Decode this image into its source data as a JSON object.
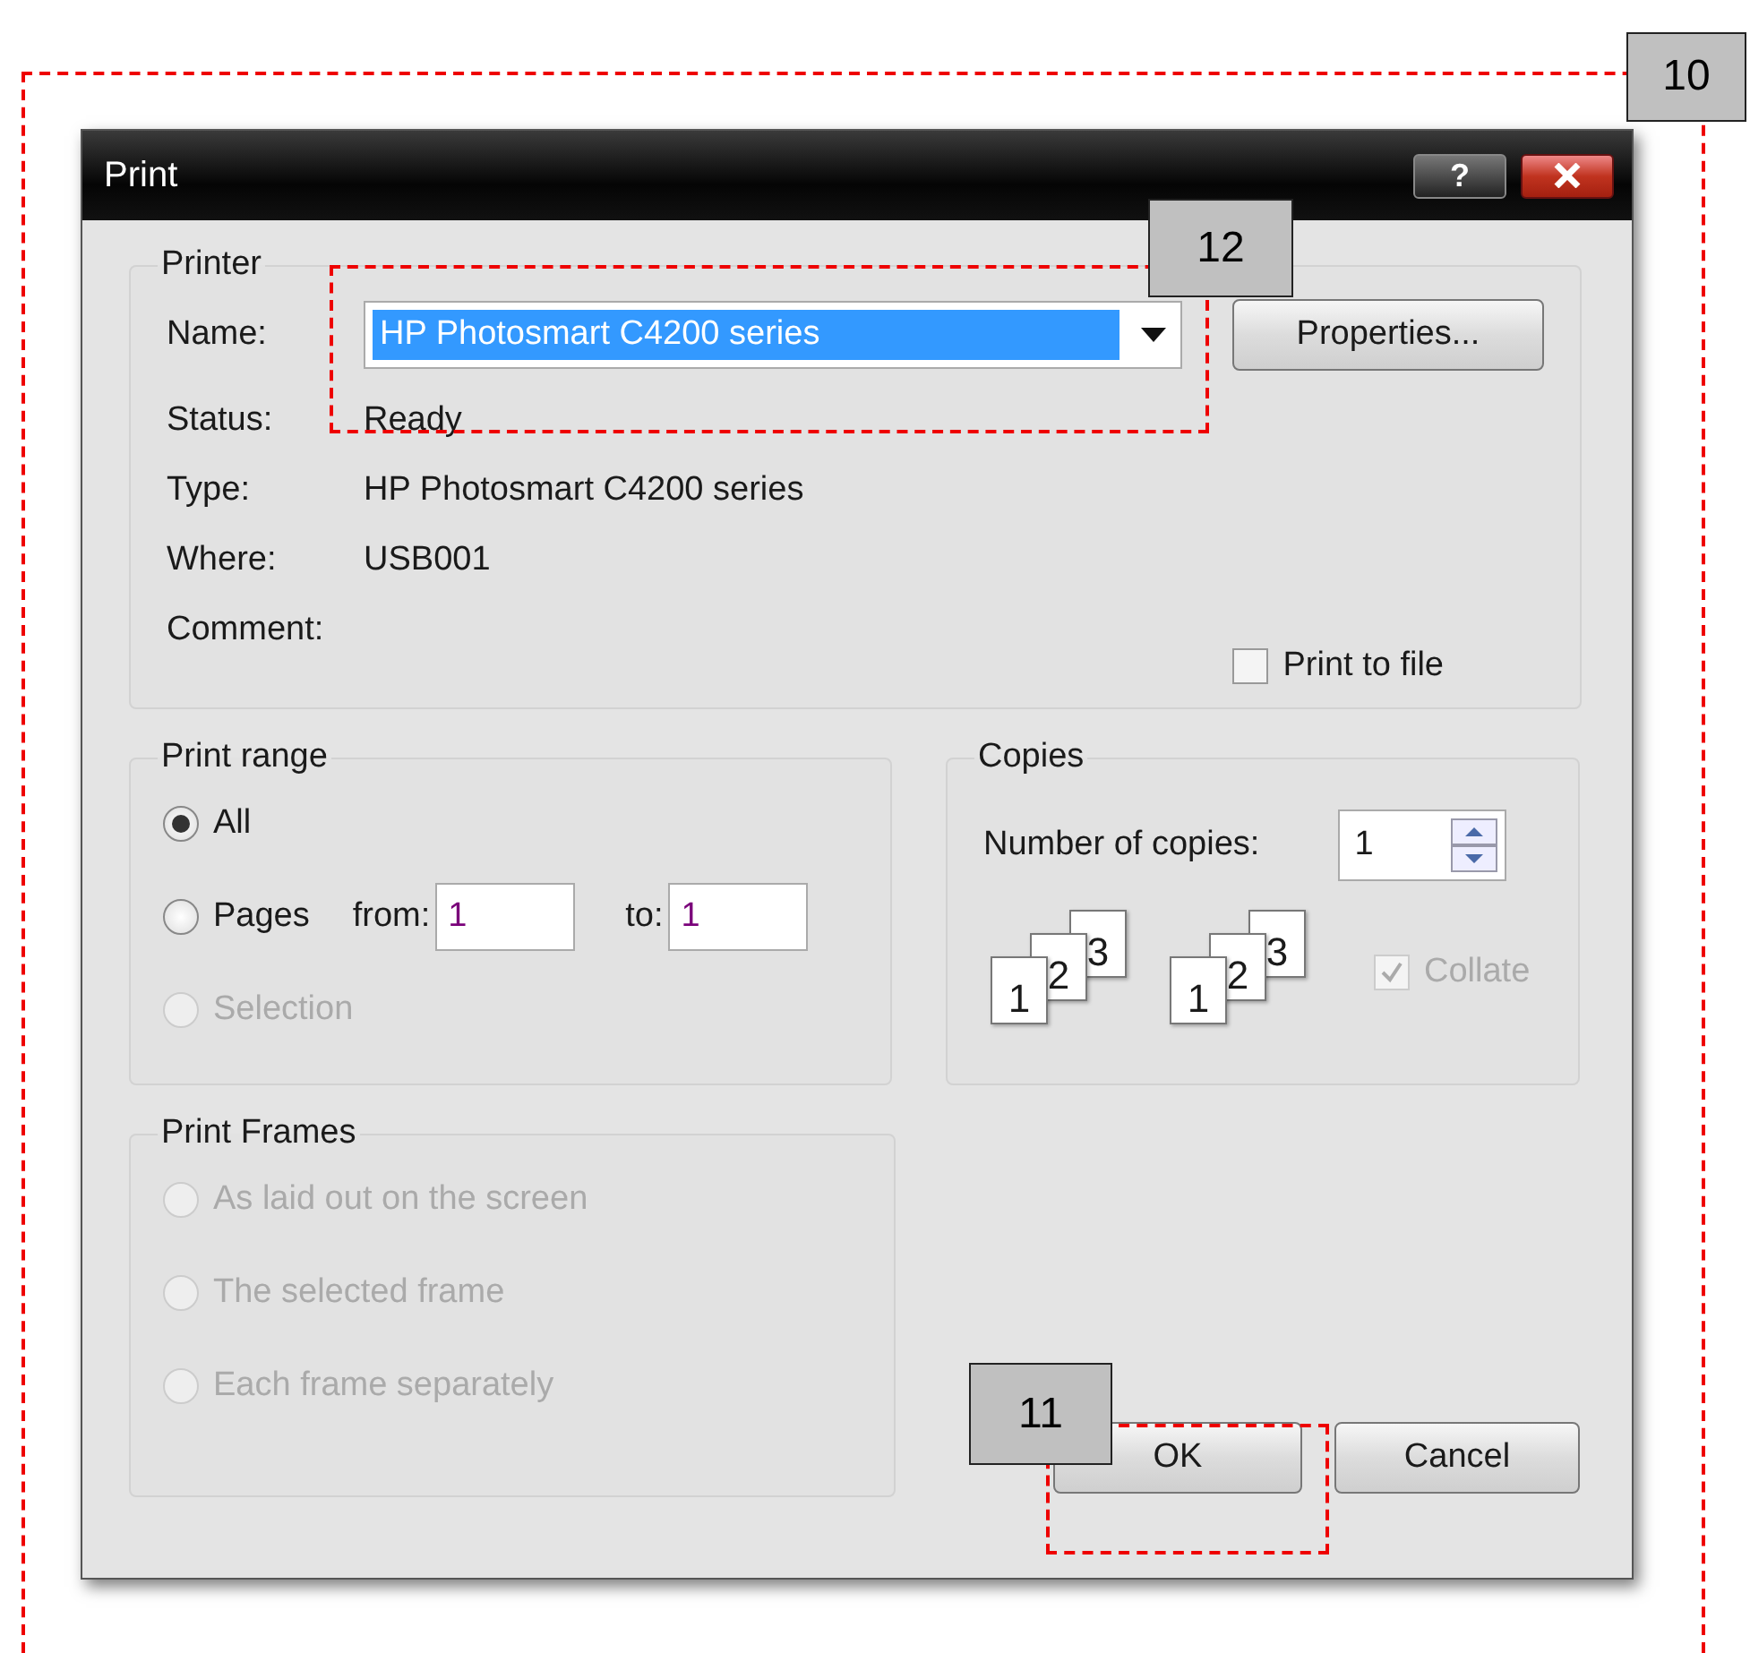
{
  "annotations": [
    {
      "label": "10"
    },
    {
      "label": "12"
    },
    {
      "label": "11"
    }
  ],
  "window": {
    "title": "Print",
    "help_button": "?"
  },
  "printer": {
    "title": "Printer",
    "name_label": "Name:",
    "name_value": "HP Photosmart C4200 series",
    "properties_button": "Properties...",
    "info": [
      {
        "label": "Status:",
        "value": "Ready"
      },
      {
        "label": "Type:",
        "value": "HP Photosmart C4200 series"
      },
      {
        "label": "Where:",
        "value": "USB001"
      },
      {
        "label": "Comment:"
      }
    ],
    "print_to_file": {
      "label": "Print to file",
      "checked": false
    }
  },
  "print_range": {
    "title": "Print range",
    "options": [
      {
        "label": "All",
        "selected": true,
        "disabled": false
      },
      {
        "label": "Pages",
        "selected": false,
        "disabled": false
      },
      {
        "label": "Selection",
        "selected": false,
        "disabled": true
      }
    ],
    "from": {
      "label": "from:",
      "value": "1"
    },
    "to": {
      "label": "to:",
      "value": "1"
    }
  },
  "copies": {
    "title": "Copies",
    "label": "Number of copies:",
    "value": "1",
    "collate": {
      "label": "Collate",
      "checked": true,
      "disabled": true
    },
    "page_stacks": [
      [
        "1",
        "2",
        "3"
      ],
      [
        "1",
        "2",
        "3"
      ]
    ]
  },
  "print_frames": {
    "title": "Print Frames",
    "options": [
      {
        "label": "As laid out on the screen",
        "selected": false,
        "disabled": true
      },
      {
        "label": "The selected frame",
        "selected": false,
        "disabled": true
      },
      {
        "label": "Each frame separately",
        "selected": false,
        "disabled": true
      }
    ]
  },
  "buttons": [
    {
      "label": "OK"
    },
    {
      "label": "Cancel"
    }
  ]
}
